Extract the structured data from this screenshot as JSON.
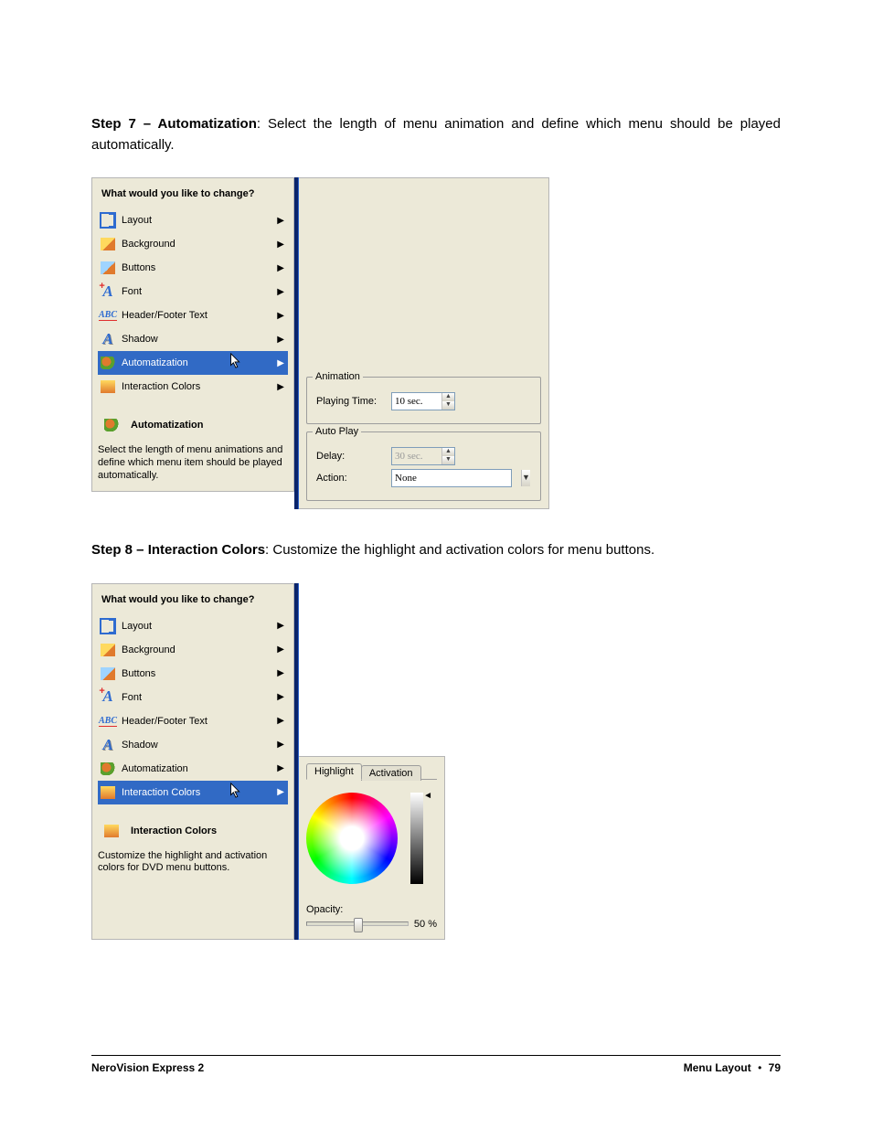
{
  "step7": {
    "title_bold": "Step 7 – Automatization",
    "title_rest": ": Select the length of menu animation and define which menu should be played automatically."
  },
  "step8": {
    "title_bold": "Step 8 – Interaction Colors",
    "title_rest": ": Customize the highlight and activation colors for menu buttons."
  },
  "menu_header": "What would you like to change?",
  "menu_items": [
    "Layout",
    "Background",
    "Buttons",
    "Font",
    "Header/Footer Text",
    "Shadow",
    "Automatization",
    "Interaction Colors"
  ],
  "fig1": {
    "selected_index": 6,
    "info_title": "Automatization",
    "info_text": "Select the length of menu animations and define which menu item should be played automatically.",
    "group_animation": "Animation",
    "playing_time_label": "Playing Time:",
    "playing_time_value": "10 sec.",
    "group_autoplay": "Auto Play",
    "delay_label": "Delay:",
    "delay_value": "30 sec.",
    "action_label": "Action:",
    "action_value": "None"
  },
  "fig2": {
    "selected_index": 7,
    "info_title": "Interaction Colors",
    "info_text": "Customize the highlight and activation colors for DVD menu buttons.",
    "tab_highlight": "Highlight",
    "tab_activation": "Activation",
    "opacity_label": "Opacity:",
    "opacity_value": "50 %",
    "opacity_percent": 50
  },
  "footer": {
    "left": "NeroVision Express 2",
    "section": "Menu Layout",
    "page": "79"
  }
}
